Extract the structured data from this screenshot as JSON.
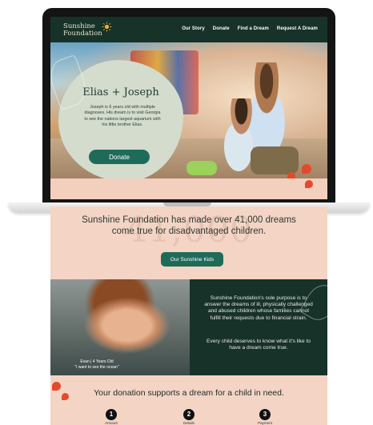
{
  "nav": {
    "logo_line1": "Sunshine",
    "logo_line2": "Foundation",
    "links": [
      "Our Story",
      "Donate",
      "Find a Dream",
      "Request A Dream"
    ]
  },
  "hero": {
    "title": "Elias + Joseph",
    "text": "Joseph is 6 years old with multiple diagnoses. His dream is to visit  Georgia to see the nations largest aquarium with his little brother Elias.",
    "donate_label": "Donate"
  },
  "stats": {
    "big_number": "41,000",
    "text": "Sunshine Foundation has made over 41,000 dreams come true for disadvantaged children.",
    "button_label": "Our Sunshine Kids"
  },
  "feature": {
    "caption_line1": "Evan | 4 Years Old",
    "caption_line2": "\"I want to see the ocean\"",
    "purpose_text": "Sunshine Foundation's sole purpose is to answer the dreams of ill, physically challenged and abused children whose families cannot fulfill their requests due to financial strain.",
    "deserve_text": "Every child deserves to know what it's like to have a dream come true."
  },
  "donation": {
    "title": "Your donation supports a dream for a child in need.",
    "steps": [
      {
        "num": "1",
        "label": "Amount"
      },
      {
        "num": "2",
        "label": "Details"
      },
      {
        "num": "3",
        "label": "Payment"
      }
    ]
  },
  "colors": {
    "dark_green": "#173228",
    "accent_green": "#1f6b5a",
    "peach": "#f4d4c5",
    "accent_red": "#e34a2b"
  }
}
